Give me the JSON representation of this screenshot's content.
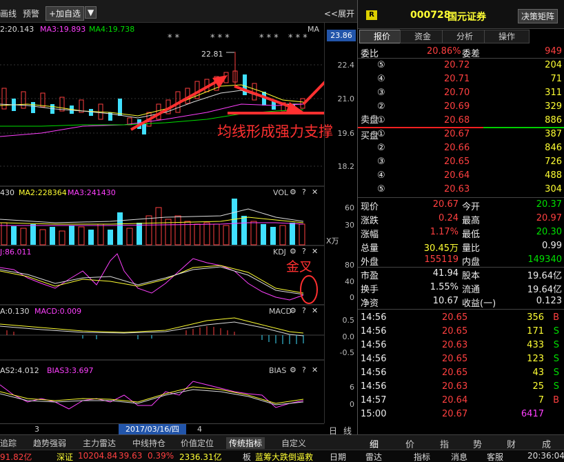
{
  "toolbar": {
    "items": [
      "画线",
      "预警"
    ],
    "add_btn": "+加自选",
    "dropdown": "▼",
    "expand": "<<展开"
  },
  "stock": {
    "badge": "R",
    "code": "000728",
    "name": "国元证券",
    "decision_btn": "决策矩阵"
  },
  "ma_line": {
    "ma2": "2:20.143",
    "ma3": "MA3:19.893",
    "ma4": "MA4:19.738",
    "ma_tag": "MA",
    "price_tag": "23.86"
  },
  "main_axis": [
    "22.4",
    "21.0",
    "19.6",
    "18.2"
  ],
  "stars": [
    "* *",
    "*  * *",
    "* * *",
    "* * *"
  ],
  "peak": "22.81",
  "annotation": "均线形成强力支撑",
  "vol": {
    "label": "430",
    "ma2": "MA2:228364",
    "ma3": "MA3:241430",
    "name": "VOL",
    "axis": [
      "60",
      "30"
    ],
    "unit": "X万"
  },
  "kdj": {
    "j": "J:86.011",
    "name": "KDJ",
    "axis": [
      "80",
      "40",
      "0"
    ],
    "note": "金叉"
  },
  "macd": {
    "a": "A:0.130",
    "macd": "MACD:0.009",
    "name": "MACD",
    "axis": [
      "0.5",
      "0.0",
      "-0.5"
    ]
  },
  "bias": {
    "a": "AS2:4.012",
    "b": "BIAS3:3.697",
    "name": "BIAS",
    "axis": [
      "6",
      "0"
    ]
  },
  "date_bar": {
    "left": "3",
    "date": "2017/03/16/四",
    "right": "4"
  },
  "right_tabs": [
    "报价",
    "资金",
    "分析",
    "操作"
  ],
  "weibi": {
    "l": "委比",
    "v": "20.86%",
    "l2": "委差",
    "v2": "949"
  },
  "sell": [
    [
      "⑤",
      "20.72",
      "204"
    ],
    [
      "④",
      "20.71",
      "71"
    ],
    [
      "③",
      "20.70",
      "311"
    ],
    [
      "②",
      "20.69",
      "329"
    ],
    [
      "①",
      "20.68",
      "886"
    ]
  ],
  "sell_label": "卖盘",
  "buy_label": "买盘",
  "buy": [
    [
      "①",
      "20.67",
      "387"
    ],
    [
      "②",
      "20.66",
      "846"
    ],
    [
      "③",
      "20.65",
      "726"
    ],
    [
      "④",
      "20.64",
      "488"
    ],
    [
      "⑤",
      "20.63",
      "304"
    ]
  ],
  "stats": [
    [
      "现价",
      "20.67",
      "今开",
      "20.37"
    ],
    [
      "涨跌",
      "0.24",
      "最高",
      "20.97"
    ],
    [
      "涨幅",
      "1.17%",
      "最低",
      "20.30"
    ],
    [
      "总量",
      "30.45万",
      "量比",
      "0.99"
    ],
    [
      "外盘",
      "155119",
      "内盘",
      "149340"
    ],
    [
      "市盈",
      "41.94",
      "股本",
      "19.64亿"
    ],
    [
      "换手",
      "1.55%",
      "流通",
      "19.64亿"
    ],
    [
      "净资",
      "10.67",
      "收益(一)",
      "0.123"
    ]
  ],
  "trades": [
    [
      "14:56",
      "20.65",
      "356",
      "B"
    ],
    [
      "14:56",
      "20.65",
      "171",
      "S"
    ],
    [
      "14:56",
      "20.63",
      "433",
      "S"
    ],
    [
      "14:56",
      "20.65",
      "123",
      "S"
    ],
    [
      "14:56",
      "20.65",
      "43",
      "S"
    ],
    [
      "14:56",
      "20.63",
      "25",
      "S"
    ],
    [
      "14:57",
      "20.64",
      "7",
      "B"
    ],
    [
      "15:00",
      "20.67",
      "6417",
      ""
    ]
  ],
  "bottom_tabs": [
    "追踪",
    "趋势强弱",
    "主力雷达",
    "中线持仓",
    "价值定位",
    "传统指标",
    "自定义",
    "日",
    "线"
  ],
  "right_bottom_tabs": [
    "细",
    "价",
    "指",
    "势",
    "财",
    "成"
  ],
  "status": {
    "cap": "91.82亿",
    "idx_name": "深证",
    "idx": "10204.84",
    "chg": "39.63",
    "pct": "0.39%",
    "amt": "2336.31亿",
    "board": "板",
    "news": "蓝筹大跌倒逼救",
    "items": [
      "日期",
      "雷达",
      "指标",
      "消息",
      "客服"
    ],
    "time": "20:36:04"
  }
}
